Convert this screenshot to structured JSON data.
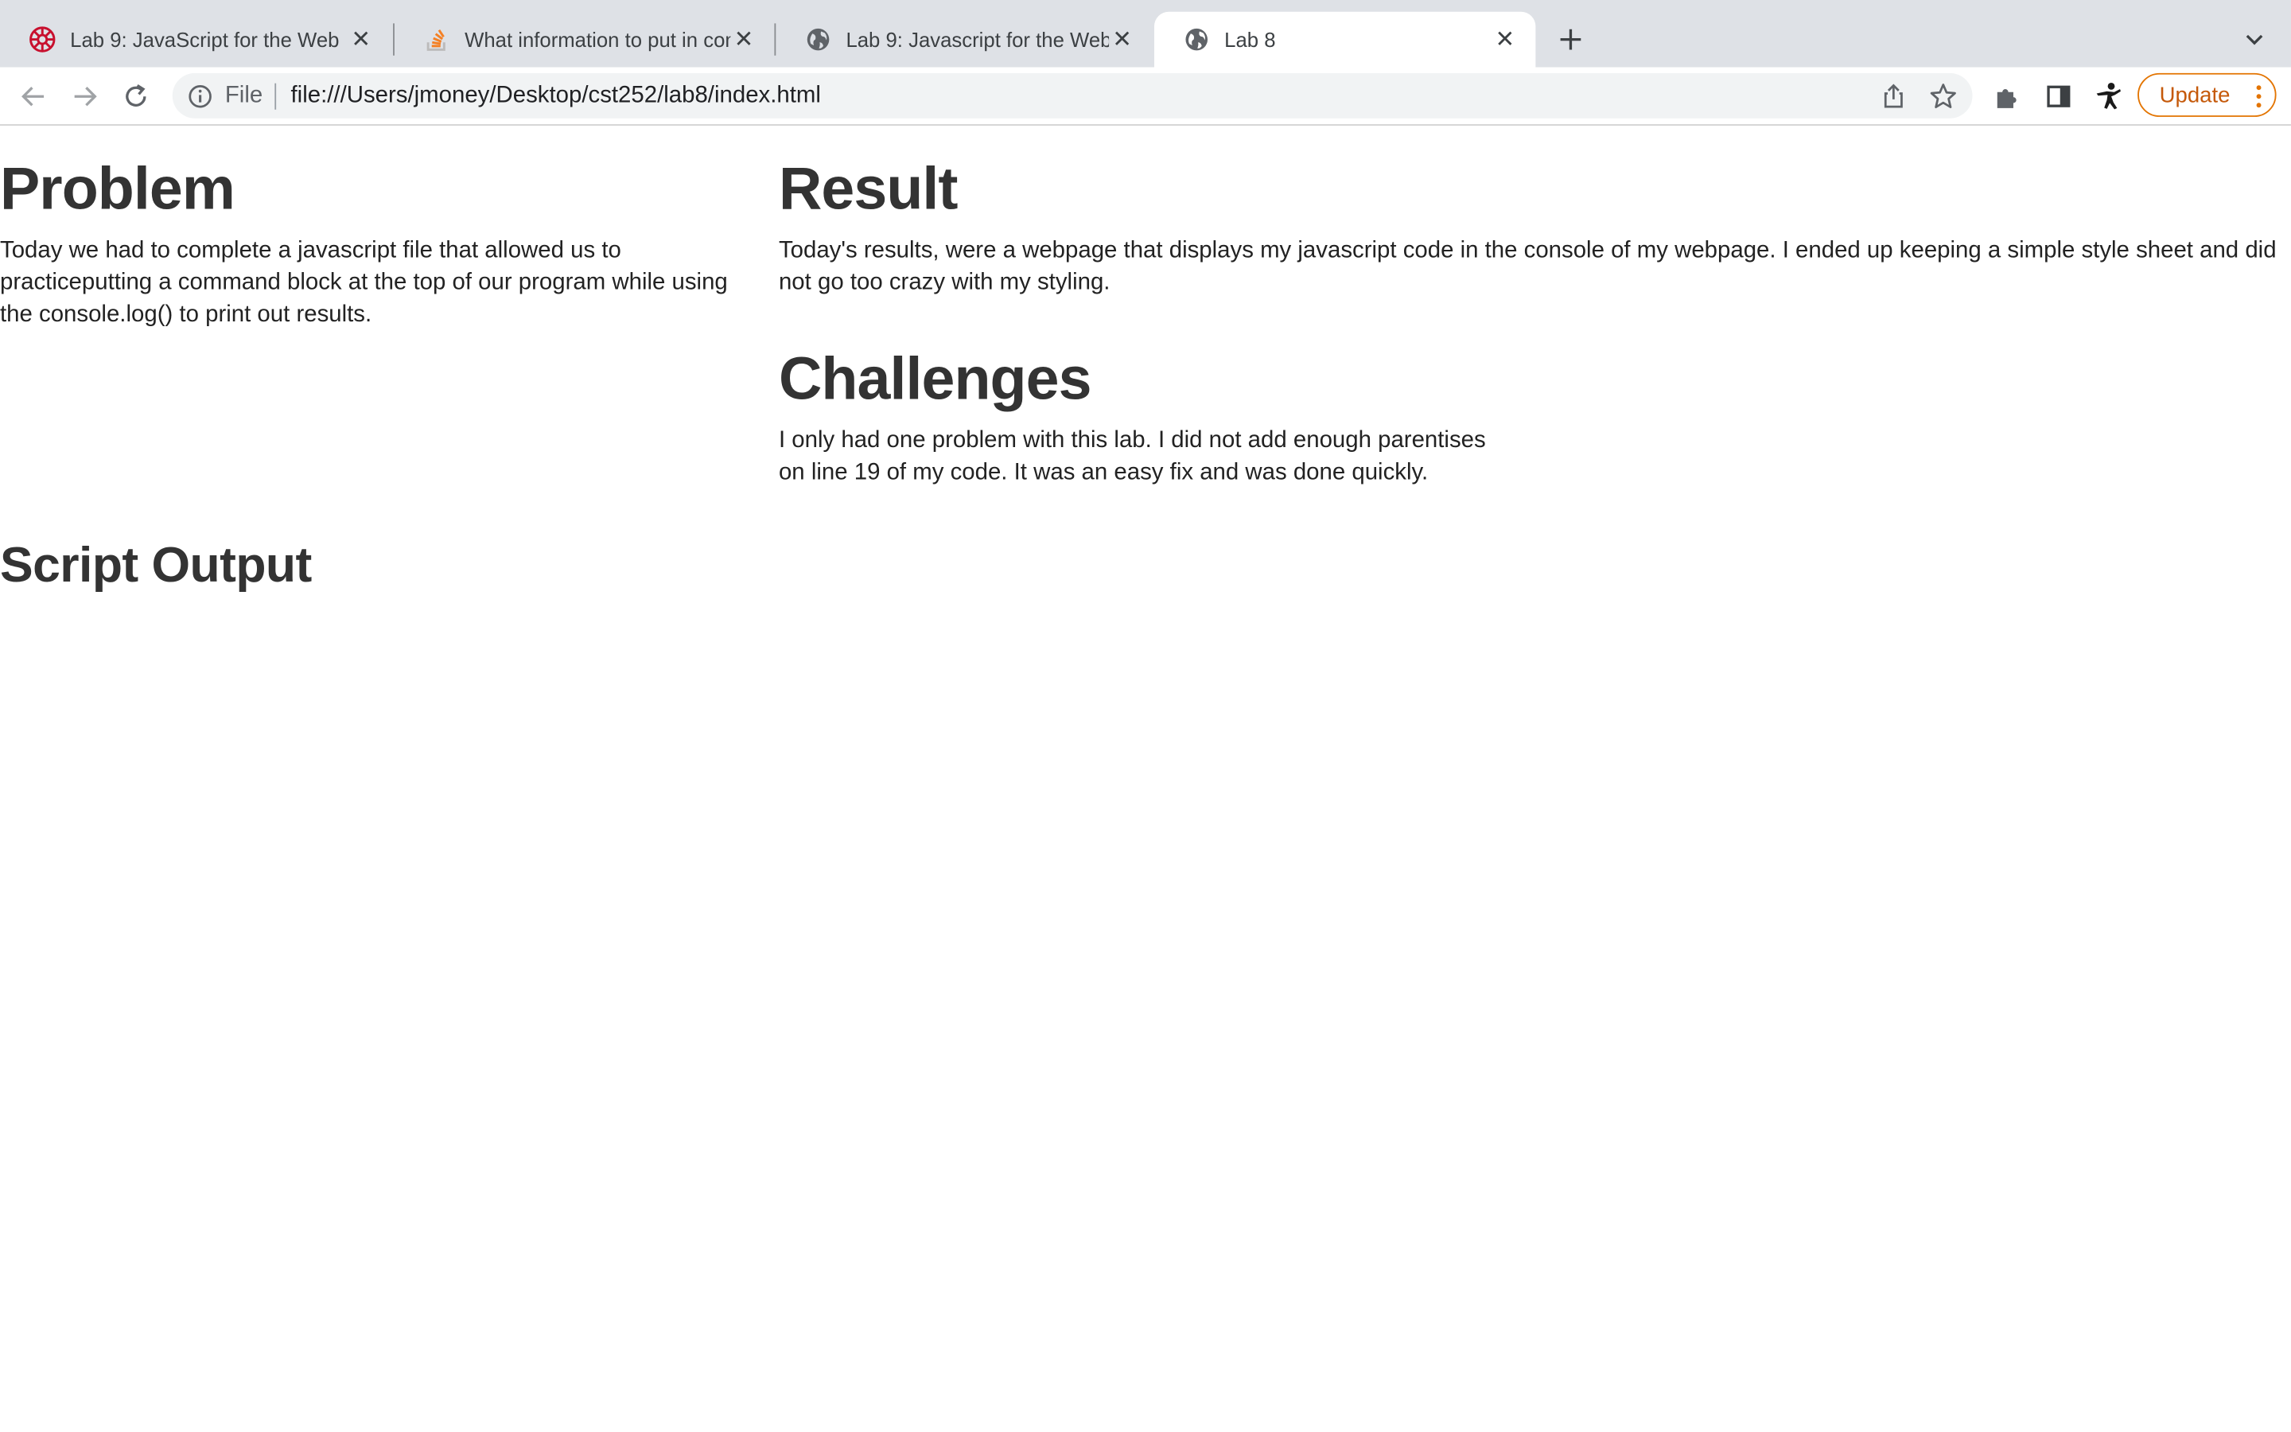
{
  "browser": {
    "tabs": [
      {
        "title": "Lab 9: JavaScript for the Web",
        "favicon": "university-logo-icon",
        "active": false
      },
      {
        "title": "What information to put in com",
        "favicon": "stackoverflow-icon",
        "active": false
      },
      {
        "title": "Lab 9: Javascript for the Web",
        "favicon": "globe-icon",
        "active": false
      },
      {
        "title": "Lab 8",
        "favicon": "globe-icon",
        "active": true
      }
    ],
    "address": {
      "scheme_label": "File",
      "url": "file:///Users/jmoney/Desktop/cst252/lab8/index.html"
    },
    "update_label": "Update",
    "accent_color": "#e37400"
  },
  "page": {
    "problem": {
      "heading": "Problem",
      "text": "Today we had to complete a javascript file that allowed us to practiceputting a command block at the top of our program while using the console.log() to print out results."
    },
    "result": {
      "heading": "Result",
      "text": "Today's results, were a webpage that displays my javascript code in the console of my webpage. I ended up keeping a simple style sheet and did not go too crazy with my styling."
    },
    "challenges": {
      "heading": "Challenges",
      "text": "I only had one problem with this lab. I did not add enough parentises on line 19 of my code. It was an easy fix and was done quickly."
    },
    "script_output": {
      "heading": "Script Output"
    }
  }
}
